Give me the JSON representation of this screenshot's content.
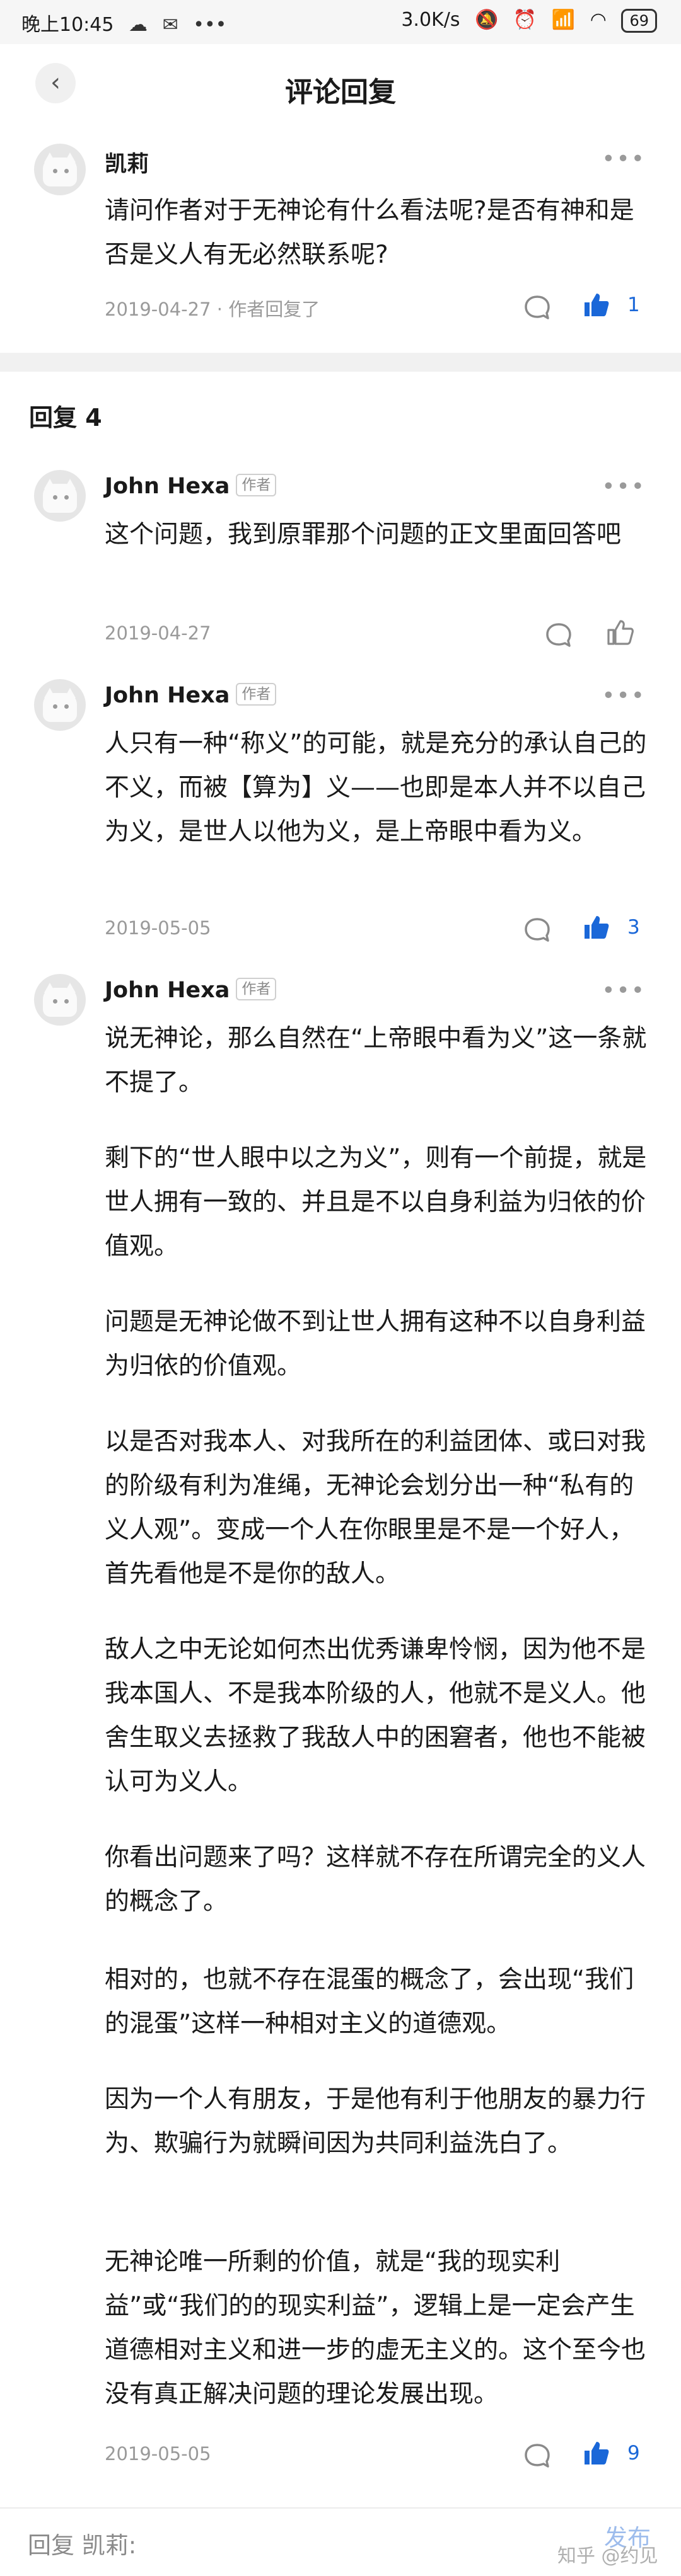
{
  "status_bar": {
    "time": "晚上10:45",
    "speed": "3.0K/s",
    "battery": "69"
  },
  "header": {
    "title": "评论回复",
    "back_glyph": "‹"
  },
  "original_comment": {
    "author": "凯莉",
    "text": "请问作者对于无神论有什么看法呢?是否有神和是否是义人有无必然联系呢?",
    "date": "2019-04-27",
    "author_replied": "· 作者回复了",
    "likes": "1",
    "liked": true
  },
  "replies_header": "回复 4",
  "replies": [
    {
      "author": "John Hexa",
      "badge": "作者",
      "paragraphs": [
        "这个问题，我到原罪那个问题的正文里面回答吧"
      ],
      "date": "2019-04-27",
      "likes": "",
      "liked": false
    },
    {
      "author": "John Hexa",
      "badge": "作者",
      "paragraphs": [
        "人只有一种“称义”的可能，就是充分的承认自己的不义，而被【算为】义——也即是本人并不以自己为义，是世人以他为义，是上帝眼中看为义。"
      ],
      "date": "2019-05-05",
      "likes": "3",
      "liked": true
    },
    {
      "author": "John Hexa",
      "badge": "作者",
      "paragraphs": [
        "说无神论，那么自然在“上帝眼中看为义”这一条就不提了。",
        "剩下的“世人眼中以之为义”，则有一个前提，就是世人拥有一致的、并且是不以自身利益为归依的价值观。",
        "问题是无神论做不到让世人拥有这种不以自身利益为归依的价值观。",
        "以是否对我本人、对我所在的利益团体、或曰对我的阶级有利为准绳，无神论会划分出一种“私有的义人观”。变成一个人在你眼里是不是一个好人，首先看他是不是你的敌人。",
        "敌人之中无论如何杰出优秀谦卑怜悯，因为他不是我本国人、不是我本阶级的人，他就不是义人。他舍生取义去拯救了我敌人中的困窘者，他也不能被认可为义人。",
        "你看出问题来了吗？这样就不存在所谓完全的义人的概念了。",
        "相对的，也就不存在混蛋的概念了，会出现“我们的混蛋”这样一种相对主义的道德观。",
        "因为一个人有朋友，于是他有利于他朋友的暴力行为、欺骗行为就瞬间因为共同利益洗白了。",
        "无神论唯一所剩的价值，就是“我的现实利益”或“我们的的现实利益”，逻辑上是一定会产生道德相对主义和进一步的虚无主义的。这个至今也没有真正解决问题的理论发展出现。"
      ],
      "date": "2019-05-05",
      "likes": "9",
      "liked": true
    }
  ],
  "more_glyph": "•••",
  "bottom_bar": {
    "placeholder": "回复 凯莉:",
    "send_label": "发布",
    "watermark": "知乎 @约见"
  },
  "colors": {
    "accent": "#1a67d8",
    "muted": "#9a9a9a",
    "divider": "#f1f1f1"
  }
}
